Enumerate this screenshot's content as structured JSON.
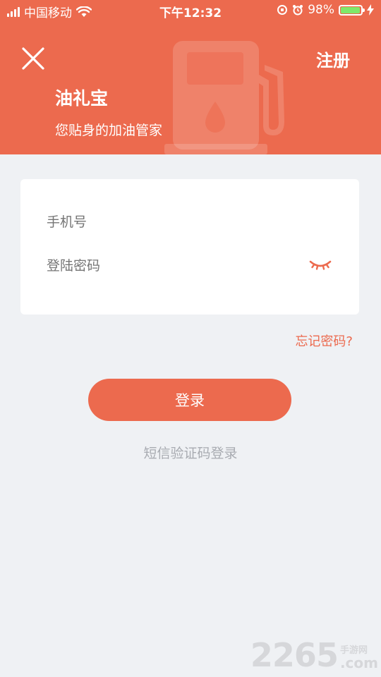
{
  "status_bar": {
    "carrier": "中国移动",
    "time": "下午12:32",
    "battery_percent": "98%",
    "battery_level": 0.98,
    "battery_color": "#7ee86a"
  },
  "header": {
    "close_icon": "close-icon",
    "register_label": "注册",
    "app_title": "油礼宝",
    "app_subtitle": "您贴身的加油管家",
    "background_color": "#ec6a4e",
    "decoration_icon": "fuel-pump-icon"
  },
  "form": {
    "phone_placeholder": "手机号",
    "password_placeholder": "登陆密码",
    "password_toggle_icon": "eye-closed-icon"
  },
  "actions": {
    "forgot_password": "忘记密码?",
    "login_button": "登录",
    "sms_login": "短信验证码登录"
  },
  "watermark": {
    "number": "2265",
    "site_cn": "手游网",
    "domain": ".com"
  }
}
